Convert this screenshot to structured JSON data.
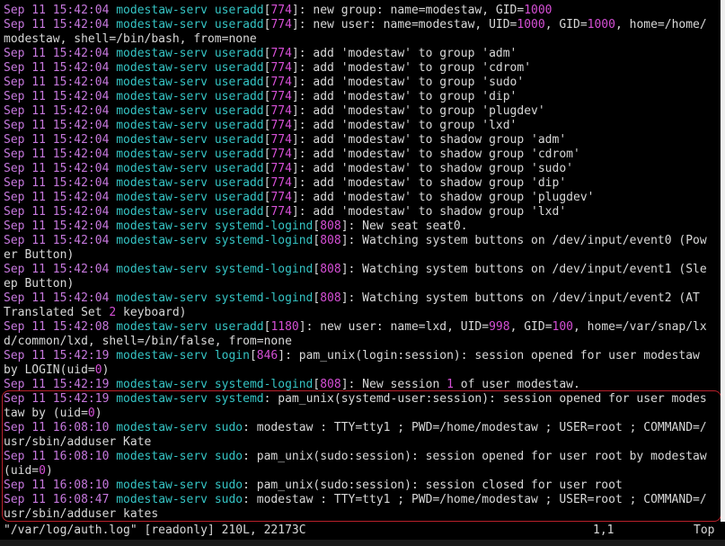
{
  "window": {
    "title": "/var/log/auth.log"
  },
  "lines": [
    [
      [
        "ts",
        "Sep 11 15:42:04"
      ],
      [
        "msg",
        " "
      ],
      [
        "host",
        "modestaw-serv"
      ],
      [
        "msg",
        " "
      ],
      [
        "proc",
        "useradd"
      ],
      [
        "msg",
        "["
      ],
      [
        "pid",
        "774"
      ],
      [
        "msg",
        "]: new group: name=modestaw, GID="
      ],
      [
        "num",
        "1000"
      ]
    ],
    [
      [
        "ts",
        "Sep 11 15:42:04"
      ],
      [
        "msg",
        " "
      ],
      [
        "host",
        "modestaw-serv"
      ],
      [
        "msg",
        " "
      ],
      [
        "proc",
        "useradd"
      ],
      [
        "msg",
        "["
      ],
      [
        "pid",
        "774"
      ],
      [
        "msg",
        "]: new user: name=modestaw, UID="
      ],
      [
        "num",
        "1000"
      ],
      [
        "msg",
        ", GID="
      ],
      [
        "num",
        "1000"
      ],
      [
        "msg",
        ", home=/home/"
      ]
    ],
    [
      [
        "cont",
        "modestaw, shell=/bin/bash, from=none"
      ]
    ],
    [
      [
        "ts",
        "Sep 11 15:42:04"
      ],
      [
        "msg",
        " "
      ],
      [
        "host",
        "modestaw-serv"
      ],
      [
        "msg",
        " "
      ],
      [
        "proc",
        "useradd"
      ],
      [
        "msg",
        "["
      ],
      [
        "pid",
        "774"
      ],
      [
        "msg",
        "]: add 'modestaw' to group 'adm'"
      ]
    ],
    [
      [
        "ts",
        "Sep 11 15:42:04"
      ],
      [
        "msg",
        " "
      ],
      [
        "host",
        "modestaw-serv"
      ],
      [
        "msg",
        " "
      ],
      [
        "proc",
        "useradd"
      ],
      [
        "msg",
        "["
      ],
      [
        "pid",
        "774"
      ],
      [
        "msg",
        "]: add 'modestaw' to group 'cdrom'"
      ]
    ],
    [
      [
        "ts",
        "Sep 11 15:42:04"
      ],
      [
        "msg",
        " "
      ],
      [
        "host",
        "modestaw-serv"
      ],
      [
        "msg",
        " "
      ],
      [
        "proc",
        "useradd"
      ],
      [
        "msg",
        "["
      ],
      [
        "pid",
        "774"
      ],
      [
        "msg",
        "]: add 'modestaw' to group 'sudo'"
      ]
    ],
    [
      [
        "ts",
        "Sep 11 15:42:04"
      ],
      [
        "msg",
        " "
      ],
      [
        "host",
        "modestaw-serv"
      ],
      [
        "msg",
        " "
      ],
      [
        "proc",
        "useradd"
      ],
      [
        "msg",
        "["
      ],
      [
        "pid",
        "774"
      ],
      [
        "msg",
        "]: add 'modestaw' to group 'dip'"
      ]
    ],
    [
      [
        "ts",
        "Sep 11 15:42:04"
      ],
      [
        "msg",
        " "
      ],
      [
        "host",
        "modestaw-serv"
      ],
      [
        "msg",
        " "
      ],
      [
        "proc",
        "useradd"
      ],
      [
        "msg",
        "["
      ],
      [
        "pid",
        "774"
      ],
      [
        "msg",
        "]: add 'modestaw' to group 'plugdev'"
      ]
    ],
    [
      [
        "ts",
        "Sep 11 15:42:04"
      ],
      [
        "msg",
        " "
      ],
      [
        "host",
        "modestaw-serv"
      ],
      [
        "msg",
        " "
      ],
      [
        "proc",
        "useradd"
      ],
      [
        "msg",
        "["
      ],
      [
        "pid",
        "774"
      ],
      [
        "msg",
        "]: add 'modestaw' to group 'lxd'"
      ]
    ],
    [
      [
        "ts",
        "Sep 11 15:42:04"
      ],
      [
        "msg",
        " "
      ],
      [
        "host",
        "modestaw-serv"
      ],
      [
        "msg",
        " "
      ],
      [
        "proc",
        "useradd"
      ],
      [
        "msg",
        "["
      ],
      [
        "pid",
        "774"
      ],
      [
        "msg",
        "]: add 'modestaw' to shadow group 'adm'"
      ]
    ],
    [
      [
        "ts",
        "Sep 11 15:42:04"
      ],
      [
        "msg",
        " "
      ],
      [
        "host",
        "modestaw-serv"
      ],
      [
        "msg",
        " "
      ],
      [
        "proc",
        "useradd"
      ],
      [
        "msg",
        "["
      ],
      [
        "pid",
        "774"
      ],
      [
        "msg",
        "]: add 'modestaw' to shadow group 'cdrom'"
      ]
    ],
    [
      [
        "ts",
        "Sep 11 15:42:04"
      ],
      [
        "msg",
        " "
      ],
      [
        "host",
        "modestaw-serv"
      ],
      [
        "msg",
        " "
      ],
      [
        "proc",
        "useradd"
      ],
      [
        "msg",
        "["
      ],
      [
        "pid",
        "774"
      ],
      [
        "msg",
        "]: add 'modestaw' to shadow group 'sudo'"
      ]
    ],
    [
      [
        "ts",
        "Sep 11 15:42:04"
      ],
      [
        "msg",
        " "
      ],
      [
        "host",
        "modestaw-serv"
      ],
      [
        "msg",
        " "
      ],
      [
        "proc",
        "useradd"
      ],
      [
        "msg",
        "["
      ],
      [
        "pid",
        "774"
      ],
      [
        "msg",
        "]: add 'modestaw' to shadow group 'dip'"
      ]
    ],
    [
      [
        "ts",
        "Sep 11 15:42:04"
      ],
      [
        "msg",
        " "
      ],
      [
        "host",
        "modestaw-serv"
      ],
      [
        "msg",
        " "
      ],
      [
        "proc",
        "useradd"
      ],
      [
        "msg",
        "["
      ],
      [
        "pid",
        "774"
      ],
      [
        "msg",
        "]: add 'modestaw' to shadow group 'plugdev'"
      ]
    ],
    [
      [
        "ts",
        "Sep 11 15:42:04"
      ],
      [
        "msg",
        " "
      ],
      [
        "host",
        "modestaw-serv"
      ],
      [
        "msg",
        " "
      ],
      [
        "proc",
        "useradd"
      ],
      [
        "msg",
        "["
      ],
      [
        "pid",
        "774"
      ],
      [
        "msg",
        "]: add 'modestaw' to shadow group 'lxd'"
      ]
    ],
    [
      [
        "ts",
        "Sep 11 15:42:04"
      ],
      [
        "msg",
        " "
      ],
      [
        "host",
        "modestaw-serv"
      ],
      [
        "msg",
        " "
      ],
      [
        "proc",
        "systemd-logind"
      ],
      [
        "msg",
        "["
      ],
      [
        "pid",
        "808"
      ],
      [
        "msg",
        "]: New seat seat0."
      ]
    ],
    [
      [
        "ts",
        "Sep 11 15:42:04"
      ],
      [
        "msg",
        " "
      ],
      [
        "host",
        "modestaw-serv"
      ],
      [
        "msg",
        " "
      ],
      [
        "proc",
        "systemd-logind"
      ],
      [
        "msg",
        "["
      ],
      [
        "pid",
        "808"
      ],
      [
        "msg",
        "]: Watching system buttons on /dev/input/event0 (Pow"
      ]
    ],
    [
      [
        "cont",
        "er Button)"
      ]
    ],
    [
      [
        "ts",
        "Sep 11 15:42:04"
      ],
      [
        "msg",
        " "
      ],
      [
        "host",
        "modestaw-serv"
      ],
      [
        "msg",
        " "
      ],
      [
        "proc",
        "systemd-logind"
      ],
      [
        "msg",
        "["
      ],
      [
        "pid",
        "808"
      ],
      [
        "msg",
        "]: Watching system buttons on /dev/input/event1 (Sle"
      ]
    ],
    [
      [
        "cont",
        "ep Button)"
      ]
    ],
    [
      [
        "ts",
        "Sep 11 15:42:04"
      ],
      [
        "msg",
        " "
      ],
      [
        "host",
        "modestaw-serv"
      ],
      [
        "msg",
        " "
      ],
      [
        "proc",
        "systemd-logind"
      ],
      [
        "msg",
        "["
      ],
      [
        "pid",
        "808"
      ],
      [
        "msg",
        "]: Watching system buttons on /dev/input/event2 (AT"
      ]
    ],
    [
      [
        "cont",
        "Translated Set "
      ],
      [
        "num",
        "2"
      ],
      [
        "cont",
        " keyboard)"
      ]
    ],
    [
      [
        "ts",
        "Sep 11 15:42:08"
      ],
      [
        "msg",
        " "
      ],
      [
        "host",
        "modestaw-serv"
      ],
      [
        "msg",
        " "
      ],
      [
        "proc",
        "useradd"
      ],
      [
        "msg",
        "["
      ],
      [
        "pid",
        "1180"
      ],
      [
        "msg",
        "]: new user: name=lxd, UID="
      ],
      [
        "num",
        "998"
      ],
      [
        "msg",
        ", GID="
      ],
      [
        "num",
        "100"
      ],
      [
        "msg",
        ", home=/var/snap/lx"
      ]
    ],
    [
      [
        "cont",
        "d/common/lxd, shell=/bin/false, from=none"
      ]
    ],
    [
      [
        "ts",
        "Sep 11 15:42:19"
      ],
      [
        "msg",
        " "
      ],
      [
        "host",
        "modestaw-serv"
      ],
      [
        "msg",
        " "
      ],
      [
        "proc",
        "login"
      ],
      [
        "msg",
        "["
      ],
      [
        "pid",
        "846"
      ],
      [
        "msg",
        "]: pam_unix(login:session): session opened for user modestaw"
      ]
    ],
    [
      [
        "cont",
        "by LOGIN(uid="
      ],
      [
        "num",
        "0"
      ],
      [
        "cont",
        ")"
      ]
    ],
    [
      [
        "ts",
        "Sep 11 15:42:19"
      ],
      [
        "msg",
        " "
      ],
      [
        "host",
        "modestaw-serv"
      ],
      [
        "msg",
        " "
      ],
      [
        "proc",
        "systemd-logind"
      ],
      [
        "msg",
        "["
      ],
      [
        "pid",
        "808"
      ],
      [
        "msg",
        "]: New session "
      ],
      [
        "num",
        "1"
      ],
      [
        "msg",
        " of user modestaw."
      ]
    ],
    [
      [
        "ts",
        "Sep 11 15:42:19"
      ],
      [
        "msg",
        " "
      ],
      [
        "host",
        "modestaw-serv"
      ],
      [
        "msg",
        " "
      ],
      [
        "proc",
        "systemd"
      ],
      [
        "msg",
        ": pam_unix(systemd-user:session): session opened for user modes"
      ]
    ],
    [
      [
        "cont",
        "taw by (uid="
      ],
      [
        "num",
        "0"
      ],
      [
        "cont",
        ")"
      ]
    ],
    [
      [
        "ts",
        "Sep 11 16:08:10"
      ],
      [
        "msg",
        " "
      ],
      [
        "host",
        "modestaw-serv"
      ],
      [
        "msg",
        " "
      ],
      [
        "proc",
        "sudo"
      ],
      [
        "msg",
        ": modestaw : TTY=tty1 ; PWD=/home/modestaw ; USER=root ; COMMAND=/"
      ]
    ],
    [
      [
        "cont",
        "usr/sbin/adduser Kate"
      ]
    ],
    [
      [
        "ts",
        "Sep 11 16:08:10"
      ],
      [
        "msg",
        " "
      ],
      [
        "host",
        "modestaw-serv"
      ],
      [
        "msg",
        " "
      ],
      [
        "proc",
        "sudo"
      ],
      [
        "msg",
        ": pam_unix(sudo:session): session opened for user root by modestaw"
      ]
    ],
    [
      [
        "cont",
        "(uid="
      ],
      [
        "num",
        "0"
      ],
      [
        "cont",
        ")"
      ]
    ],
    [
      [
        "ts",
        "Sep 11 16:08:10"
      ],
      [
        "msg",
        " "
      ],
      [
        "host",
        "modestaw-serv"
      ],
      [
        "msg",
        " "
      ],
      [
        "proc",
        "sudo"
      ],
      [
        "msg",
        ": pam_unix(sudo:session): session closed for user root"
      ]
    ],
    [
      [
        "ts",
        "Sep 11 16:08:47"
      ],
      [
        "msg",
        " "
      ],
      [
        "host",
        "modestaw-serv"
      ],
      [
        "msg",
        " "
      ],
      [
        "proc",
        "sudo"
      ],
      [
        "msg",
        ": modestaw : TTY=tty1 ; PWD=/home/modestaw ; USER=root ; COMMAND=/"
      ]
    ],
    [
      [
        "cont",
        "usr/sbin/adduser kates"
      ]
    ]
  ],
  "statusbar": {
    "file": "\"/var/log/auth.log\" [readonly] 210L, 22173C",
    "position": "1,1",
    "scroll": "Top"
  },
  "colors": {
    "background": "#000000",
    "timestamp": "#c678dd",
    "hostname": "#35c4c4",
    "number": "#d54fd5",
    "text": "#d8d8d8",
    "highlight_border": "#b8202a"
  }
}
